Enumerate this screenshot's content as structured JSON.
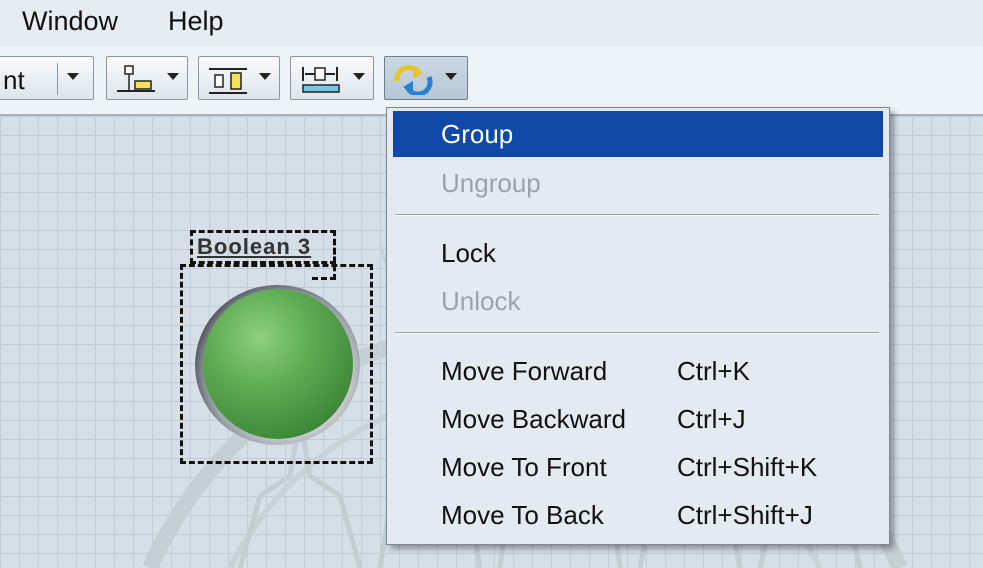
{
  "menubar": {
    "items": [
      {
        "label": "Window"
      },
      {
        "label": "Help"
      }
    ]
  },
  "toolbar": {
    "font_dropdown_text": "nt",
    "buttons": [
      {
        "icon": "align-objects-icon"
      },
      {
        "icon": "distribute-objects-icon"
      },
      {
        "icon": "resize-objects-icon"
      },
      {
        "icon": "reorder-icon",
        "pressed": true
      }
    ]
  },
  "canvas": {
    "control_label": "Boolean 3"
  },
  "reorder_menu": {
    "items": [
      {
        "label": "Group",
        "shortcut": "",
        "selected": true,
        "enabled": true
      },
      {
        "label": "Ungroup",
        "shortcut": "",
        "enabled": false
      },
      {
        "label": "Lock",
        "shortcut": "",
        "enabled": true
      },
      {
        "label": "Unlock",
        "shortcut": "",
        "enabled": false
      },
      {
        "label": "Move Forward",
        "shortcut": "Ctrl+K",
        "enabled": true
      },
      {
        "label": "Move Backward",
        "shortcut": "Ctrl+J",
        "enabled": true
      },
      {
        "label": "Move To Front",
        "shortcut": "Ctrl+Shift+K",
        "enabled": true
      },
      {
        "label": "Move To Back",
        "shortcut": "Ctrl+Shift+J",
        "enabled": true
      }
    ]
  },
  "colors": {
    "selection": "#1048a8",
    "led_green": "#61ad56",
    "canvas_bg": "#d6dfe8",
    "menu_bg": "#e4eaf1"
  }
}
